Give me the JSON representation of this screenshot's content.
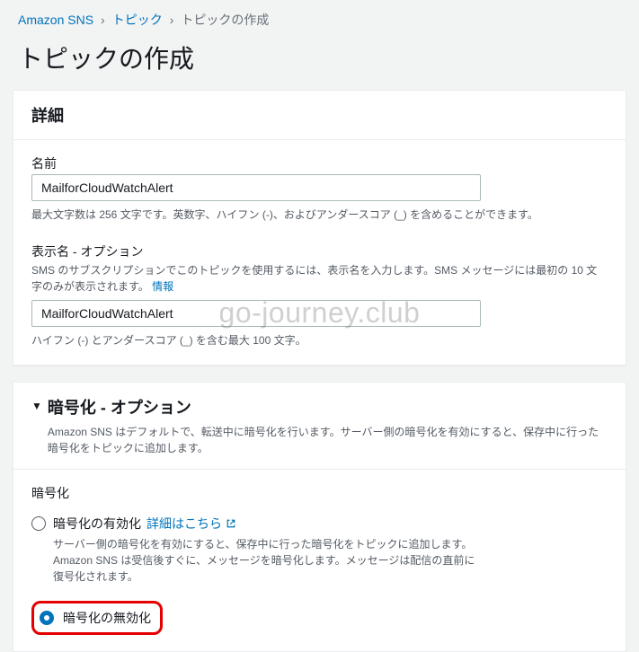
{
  "breadcrumb": {
    "root": "Amazon SNS",
    "level1": "トピック",
    "current": "トピックの作成"
  },
  "page_title": "トピックの作成",
  "details": {
    "header": "詳細",
    "name": {
      "label": "名前",
      "value": "MailforCloudWatchAlert",
      "hint": "最大文字数は 256 文字です。英数字、ハイフン (-)、およびアンダースコア (_) を含めることができます。"
    },
    "display_name": {
      "label": "表示名 - オプション",
      "desc": "SMS のサブスクリプションでこのトピックを使用するには、表示名を入力します。SMS メッセージには最初の 10 文字のみが表示されます。",
      "info_link": "情報",
      "value": "MailforCloudWatchAlert",
      "hint": "ハイフン (-) とアンダースコア (_) を含む最大 100 文字。"
    }
  },
  "encryption": {
    "header": "暗号化 - オプション",
    "header_desc": "Amazon SNS はデフォルトで、転送中に暗号化を行います。サーバー側の暗号化を有効にすると、保存中に行った暗号化をトピックに追加します。",
    "section_label": "暗号化",
    "enable": {
      "label": "暗号化の有効化",
      "learn_more": "詳細はこちら",
      "desc": "サーバー側の暗号化を有効にすると、保存中に行った暗号化をトピックに追加します。Amazon SNS は受信後すぐに、メッセージを暗号化します。メッセージは配信の直前に復号化されます。"
    },
    "disable": {
      "label": "暗号化の無効化"
    }
  },
  "watermark": "go-journey.club"
}
